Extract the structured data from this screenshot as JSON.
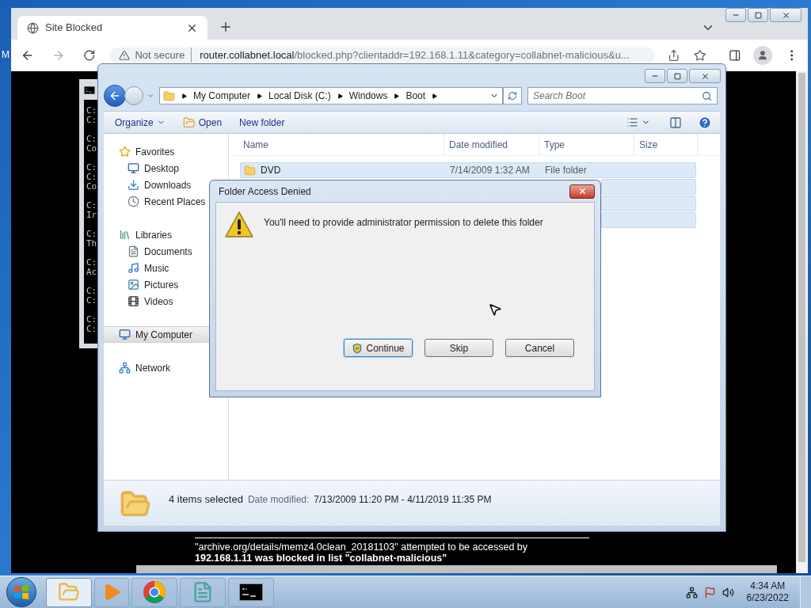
{
  "desktop": {
    "edge_text": "M"
  },
  "browser": {
    "tabs": [
      {
        "title": "Site Blocked",
        "selected": true
      }
    ],
    "address": {
      "security": "Not secure",
      "host": "router.collabnet.local",
      "path": "/blocked.php?clientaddr=192.168.1.11&category=collabnet-malicious&u..."
    },
    "page_lines": [
      "\"archive.org/details/memz4.0clean_20181103\" attempted to be accessed by",
      "192.168.1.11 was blocked in list \"collabnet-malicious\""
    ]
  },
  "console": {
    "blocks": [
      [
        "C:",
        "C:"
      ],
      [
        "C:",
        "Co"
      ],
      [
        "C:",
        "C:",
        "Co"
      ],
      [
        "C:",
        "Ir"
      ],
      [
        "C:",
        "Th"
      ],
      [
        "C:",
        "Ac"
      ],
      [
        "C:",
        "C:"
      ],
      [
        "C:",
        "C:"
      ]
    ]
  },
  "explorer": {
    "breadcrumb": [
      "My Computer",
      "Local Disk (C:)",
      "Windows",
      "Boot"
    ],
    "search": {
      "placeholder": "Search Boot"
    },
    "toolbar": [
      {
        "label": "Organize",
        "kind": "menu"
      },
      {
        "label": "Open",
        "kind": "open"
      },
      {
        "label": "New folder",
        "kind": "plain"
      }
    ],
    "nav": [
      {
        "label": "Favorites",
        "kind": "star",
        "selected": false,
        "children": [
          {
            "label": "Desktop",
            "kind": "desktop",
            "selected": false
          },
          {
            "label": "Downloads",
            "kind": "downloads",
            "selected": false
          },
          {
            "label": "Recent Places",
            "kind": "recent",
            "selected": false
          }
        ]
      },
      {
        "label": "Libraries",
        "kind": "library",
        "selected": false,
        "children": [
          {
            "label": "Documents",
            "kind": "documents",
            "selected": false
          },
          {
            "label": "Music",
            "kind": "music",
            "selected": false
          },
          {
            "label": "Pictures",
            "kind": "pictures",
            "selected": false
          },
          {
            "label": "Videos",
            "kind": "videos",
            "selected": false
          }
        ]
      },
      {
        "label": "My Computer",
        "kind": "computer",
        "selected": true
      },
      {
        "label": "Network",
        "kind": "network",
        "selected": false
      }
    ],
    "columns": [
      "Name",
      "Date modified",
      "Type",
      "Size"
    ],
    "rows": [
      {
        "name": "DVD",
        "date": "7/14/2009 1:32 AM",
        "type": "File folder",
        "selected": true
      },
      {
        "selected": true
      },
      {
        "selected": true
      },
      {
        "selected": true
      }
    ],
    "details": {
      "summary": "4 items selected",
      "label": "Date modified:",
      "value": "7/13/2009 11:20 PM - 4/11/2019 11:35 PM"
    }
  },
  "dialog": {
    "title": "Folder Access Denied",
    "message": "You'll need to provide administrator permission to delete this folder",
    "buttons": [
      {
        "label": "Continue",
        "kind": "shield",
        "default": true
      },
      {
        "label": "Skip",
        "kind": "plain",
        "default": false
      },
      {
        "label": "Cancel",
        "kind": "plain",
        "default": false
      }
    ]
  },
  "taskbar": {
    "apps": [
      {
        "kind": "explorer",
        "selected": true
      },
      {
        "kind": "media",
        "selected": false
      },
      {
        "kind": "browser",
        "selected": false
      },
      {
        "kind": "notepad",
        "selected": false
      },
      {
        "kind": "console",
        "selected": false
      }
    ],
    "time": "4:34 AM",
    "date": "6/23/2022"
  }
}
